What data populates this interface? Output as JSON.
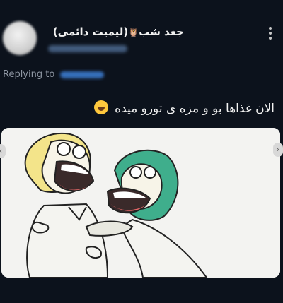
{
  "post": {
    "display_name": "جغد شب",
    "display_name_suffix": "(لیمیت دائمی)",
    "reply_prefix": "Replying to",
    "text": "الان غذاها بو و مزه ی تورو میده",
    "emoji_icon": "rolling-on-floor-laughing-emoji",
    "media": "illustration of two cartoon characters laughing and hugging"
  },
  "colors": {
    "background": "#0c121c",
    "link": "#3d7fd6",
    "muted": "#8f97a3"
  }
}
